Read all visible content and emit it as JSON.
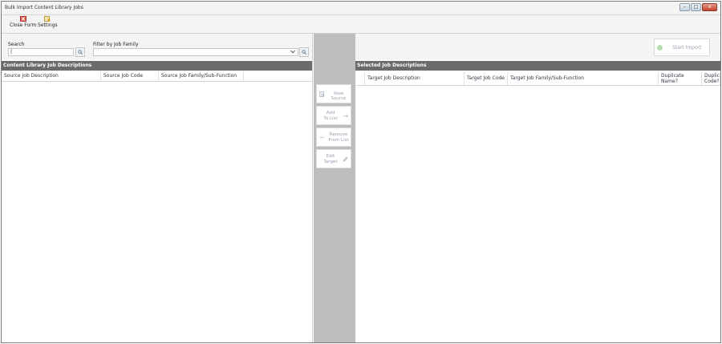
{
  "window": {
    "title": "Bulk Import Content Library Jobs",
    "controls": {
      "minimize": "–",
      "maximize": "□",
      "close": "x"
    }
  },
  "toolbar": {
    "close_form_label": "Close Form",
    "settings_label": "Settings"
  },
  "filters": {
    "search_label": "Search",
    "search_value": "|",
    "filter_label": "Filter by Job Family",
    "filter_value": ""
  },
  "left_panel": {
    "header": "Content Library Job Descriptions",
    "columns": [
      "Source Job Description",
      "Source Job Code",
      "Source Job Family/Sub-Function"
    ]
  },
  "actions": {
    "view_source": "View Source",
    "add_to_list_line1": "Add",
    "add_to_list_line2": "To List",
    "remove_from_list_line1": "Remove",
    "remove_from_list_line2": "From List",
    "edit_target_line1": "Edit",
    "edit_target_line2": "Target"
  },
  "right_panel": {
    "start_import": "Start Import",
    "header": "Selected Job Descriptions",
    "columns": {
      "c1": "Target Job Description",
      "c2": "Target Job Code",
      "c3": "Target Job Family/Sub-Function",
      "c4_line1": "Duplicate",
      "c4_line2": "Name?",
      "c5_line1": "Duplicate",
      "c5_line2": "Code?"
    }
  },
  "colors": {
    "header_gray": "#6b6b6b",
    "middle_gray": "#bdbdbd",
    "toolbar_bg": "#f4f4f4"
  },
  "icons": [
    "close-form-icon",
    "settings-icon",
    "search-icon",
    "chevron-down-icon",
    "view-source-icon",
    "arrow-right-icon",
    "minus-icon",
    "pencil-icon",
    "check-circle-icon"
  ]
}
